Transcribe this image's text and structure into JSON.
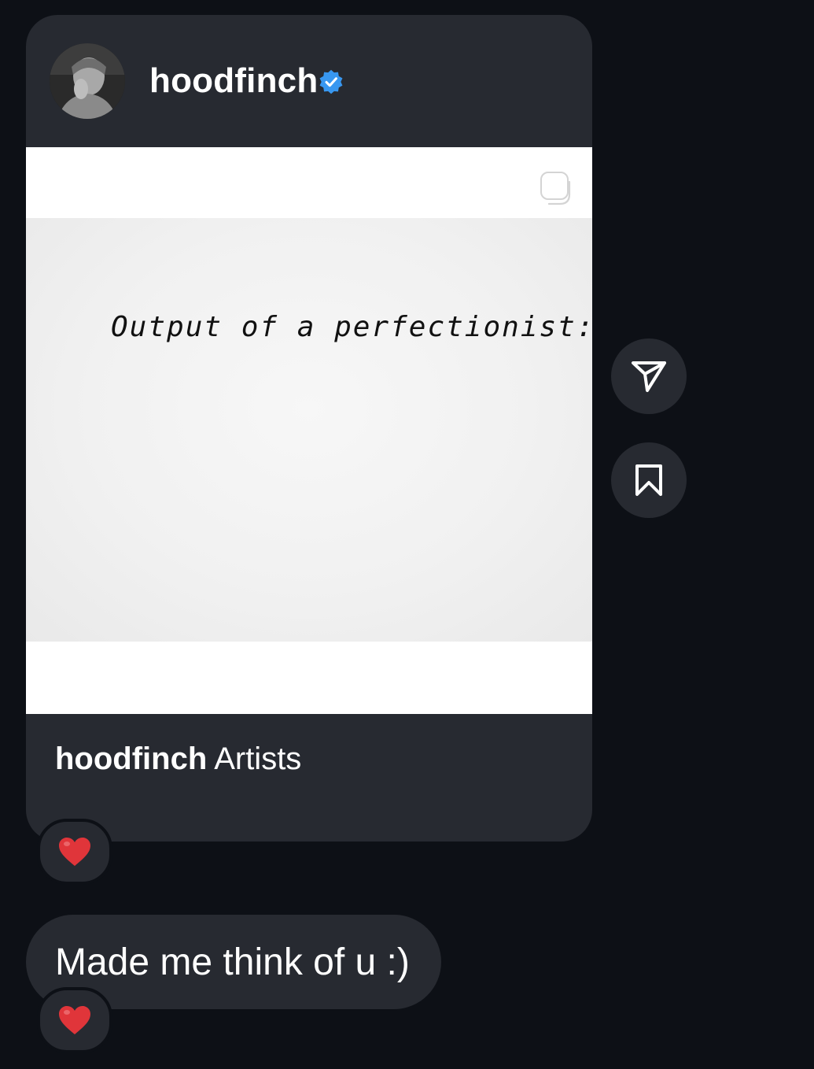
{
  "post": {
    "author": "hoodfinch",
    "verified_icon": "verified-badge-icon",
    "image": {
      "handwritten_text": "Output of a perfectionist:",
      "multi_icon": "carousel-icon"
    },
    "caption": {
      "username": "hoodfinch",
      "text": "Artists"
    },
    "reaction": "❤️"
  },
  "actions": {
    "share_icon": "paper-plane-icon",
    "save_icon": "bookmark-icon"
  },
  "message": {
    "text": "Made me think of u :)",
    "reaction": "❤️"
  },
  "colors": {
    "background": "#0d1016",
    "bubble": "#272a31",
    "verified": "#3897f0",
    "heart": "#e0353a"
  }
}
